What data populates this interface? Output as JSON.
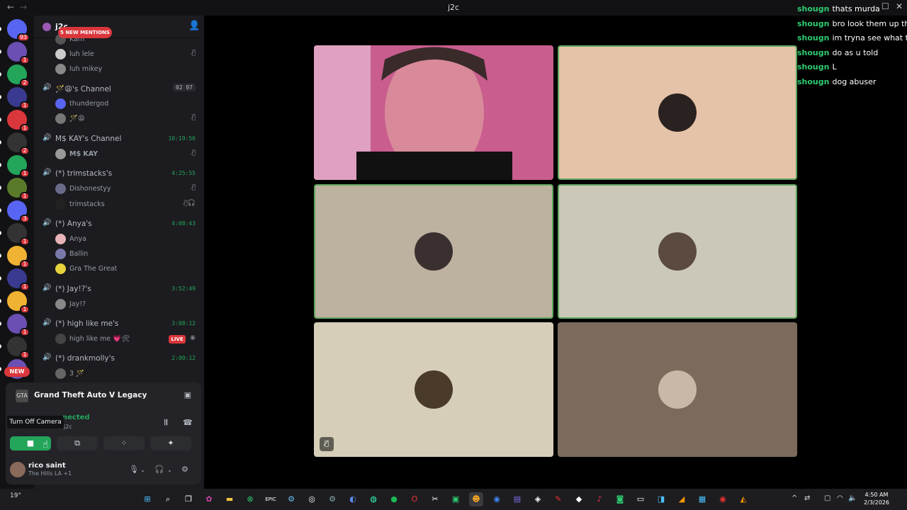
{
  "window": {
    "title": "j2c"
  },
  "server": {
    "name": "j2c",
    "mentions_pill": "5 NEW MENTIONS"
  },
  "guilds": [
    {
      "badge": "93",
      "color": "#5865f2"
    },
    {
      "badge": "1",
      "color": "#6b4fb3"
    },
    {
      "badge": "2",
      "color": "#23a55a"
    },
    {
      "badge": "1",
      "color": "#3a3a90"
    },
    {
      "badge": "1",
      "color": "#da373c"
    },
    {
      "badge": "2",
      "color": "#333"
    },
    {
      "badge": "1",
      "color": "#23a55a"
    },
    {
      "badge": "1",
      "color": "#5a7a2a"
    },
    {
      "badge": "3",
      "color": "#5865f2"
    },
    {
      "badge": "1",
      "color": "#333"
    },
    {
      "badge": "1",
      "color": "#f0b232"
    },
    {
      "badge": "1",
      "color": "#3a3a90"
    },
    {
      "badge": "1",
      "color": "#f0b232"
    },
    {
      "badge": "1",
      "color": "#6b4fb3"
    },
    {
      "badge": "1",
      "color": "#333"
    },
    {
      "badge": "",
      "color": "#6b4fb3"
    }
  ],
  "guild_new_pill": "NEW",
  "channels": {
    "top_users": [
      "Kam",
      "luh lele",
      "luh mikey"
    ],
    "ch1": {
      "name": "🪄😩's Channel",
      "timer": "02 07"
    },
    "ch1_users": [
      "thundergod",
      "🪄😩"
    ],
    "ch2": {
      "name": "M$ KAY's Channel",
      "timer": "10:19:56"
    },
    "ch2_users": [
      "M$ KAY"
    ],
    "ch3": {
      "name": "(*) trimstacks's",
      "timer": "4:25:55"
    },
    "ch3_users": [
      "Dishonestyy",
      "trimstacks"
    ],
    "ch4": {
      "name": "(*) Anya's",
      "timer": "4:08:43"
    },
    "ch4_users": [
      "Anya",
      "Ballin",
      "Gra The Great"
    ],
    "ch5": {
      "name": "(*) Jay!?'s",
      "timer": "3:52:49"
    },
    "ch5_users": [
      "Jay!?"
    ],
    "ch6": {
      "name": "(*) high like me's",
      "timer": "3:08:12"
    },
    "ch6_users": [
      "high like me 💗🛠"
    ],
    "live_label": "LIVE",
    "ch7": {
      "name": "(*) drankmolly's",
      "timer": "2:00:12"
    },
    "ch7_users": [
      "3 🪄"
    ]
  },
  "panel": {
    "activity": "Grand Theft Auto V Legacy",
    "voice_status": "nected",
    "voice_sub": "j2c",
    "tooltip": "Turn Off Camera"
  },
  "user": {
    "name": "rico saint",
    "status": "The Hills LA +1"
  },
  "chat": [
    {
      "user": "shougn",
      "msg": "thats murda"
    },
    {
      "user": "shougn",
      "msg": "bro look them up the"
    },
    {
      "user": "shougn",
      "msg": "im tryna see what the"
    },
    {
      "user": "shougn",
      "msg": "do as u told"
    },
    {
      "user": "shougn",
      "msg": "L"
    },
    {
      "user": "shougn",
      "msg": "dog abuser"
    }
  ],
  "tiles": [
    {
      "bg": "#c95d8e",
      "speaking": false
    },
    {
      "bg": "#e5c3a8",
      "speaking": true
    },
    {
      "bg": "#bdb19f",
      "speaking": true
    },
    {
      "bg": "#cbc8b9",
      "speaking": true
    },
    {
      "bg": "#d6ceb8",
      "speaking": false
    },
    {
      "bg": "#7c6b5d",
      "speaking": false
    }
  ],
  "taskbar": {
    "weather": "19°",
    "time": "4:50 AM",
    "date": "2/3/2026"
  }
}
